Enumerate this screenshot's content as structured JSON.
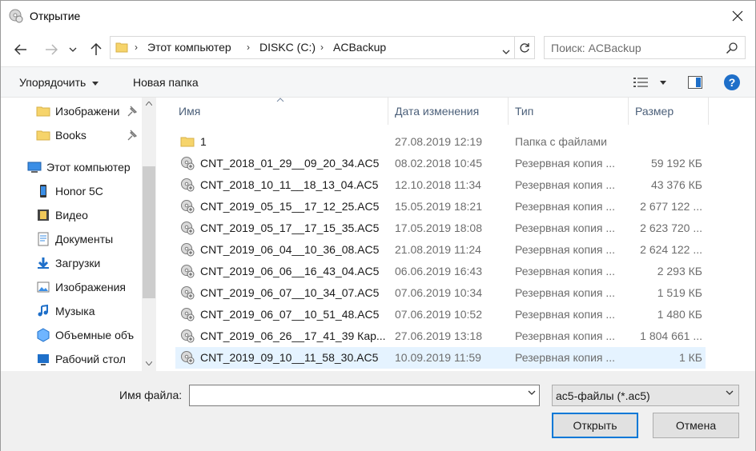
{
  "window": {
    "title": "Открытие"
  },
  "breadcrumb": [
    "Этот компьютер",
    "DISKC (C:)",
    "ACBackup"
  ],
  "search": {
    "placeholder": "Поиск: ACBackup"
  },
  "toolbar": {
    "organize_label": "Упорядочить",
    "new_folder_label": "Новая папка"
  },
  "sidebar": {
    "items": [
      {
        "label": "Изображени",
        "icon": "folder-icon",
        "pinned": true
      },
      {
        "label": "Books",
        "icon": "folder-icon",
        "pinned": true
      },
      {
        "label": "Этот компьютер",
        "icon": "computer-icon"
      },
      {
        "label": "Honor 5C",
        "icon": "phone-icon"
      },
      {
        "label": "Видео",
        "icon": "video-folder-icon"
      },
      {
        "label": "Документы",
        "icon": "documents-folder-icon"
      },
      {
        "label": "Загрузки",
        "icon": "downloads-folder-icon"
      },
      {
        "label": "Изображения",
        "icon": "pictures-folder-icon"
      },
      {
        "label": "Музыка",
        "icon": "music-folder-icon"
      },
      {
        "label": "Объемные объ",
        "icon": "3d-objects-folder-icon"
      },
      {
        "label": "Рабочий стол",
        "icon": "desktop-folder-icon"
      }
    ]
  },
  "columns": {
    "name": "Имя",
    "date": "Дата изменения",
    "type": "Тип",
    "size": "Размер"
  },
  "files": [
    {
      "name": "1",
      "date": "27.08.2019 12:19",
      "type": "Папка с файлами",
      "size": "",
      "kind": "folder"
    },
    {
      "name": "CNT_2018_01_29__09_20_34.AC5",
      "date": "08.02.2018 10:45",
      "type": "Резервная копия ...",
      "size": "59 192 КБ",
      "kind": "file"
    },
    {
      "name": "CNT_2018_10_11__18_13_04.AC5",
      "date": "12.10.2018 11:34",
      "type": "Резервная копия ...",
      "size": "43 376 КБ",
      "kind": "file"
    },
    {
      "name": "CNT_2019_05_15__17_12_25.AC5",
      "date": "15.05.2019 18:21",
      "type": "Резервная копия ...",
      "size": "2 677 122 ...",
      "kind": "file"
    },
    {
      "name": "CNT_2019_05_17__17_15_35.AC5",
      "date": "17.05.2019 18:08",
      "type": "Резервная копия ...",
      "size": "2 623 720 ...",
      "kind": "file"
    },
    {
      "name": "CNT_2019_06_04__10_36_08.AC5",
      "date": "21.08.2019 11:24",
      "type": "Резервная копия ...",
      "size": "2 624 122 ...",
      "kind": "file"
    },
    {
      "name": "CNT_2019_06_06__16_43_04.AC5",
      "date": "06.06.2019 16:43",
      "type": "Резервная копия ...",
      "size": "2 293 КБ",
      "kind": "file"
    },
    {
      "name": "CNT_2019_06_07__10_34_07.AC5",
      "date": "07.06.2019 10:34",
      "type": "Резервная копия ...",
      "size": "1 519 КБ",
      "kind": "file"
    },
    {
      "name": "CNT_2019_06_07__10_51_48.AC5",
      "date": "07.06.2019 10:52",
      "type": "Резервная копия ...",
      "size": "1 480 КБ",
      "kind": "file"
    },
    {
      "name": "CNT_2019_06_26__17_41_39 Кар...",
      "date": "27.06.2019 13:18",
      "type": "Резервная копия ...",
      "size": "1 804 661 ...",
      "kind": "file"
    },
    {
      "name": "CNT_2019_09_10__11_58_30.AC5",
      "date": "10.09.2019 11:59",
      "type": "Резервная копия ...",
      "size": "1 КБ",
      "kind": "file",
      "selected": true
    }
  ],
  "footer": {
    "filename_label": "Имя файла:",
    "filename_value": "",
    "filter_label": "ac5-файлы (*.ac5)",
    "open_label": "Открыть",
    "cancel_label": "Отмена"
  },
  "colors": {
    "accent": "#0078d7",
    "selection": "#e5f3ff",
    "header_text": "#4c607a"
  }
}
